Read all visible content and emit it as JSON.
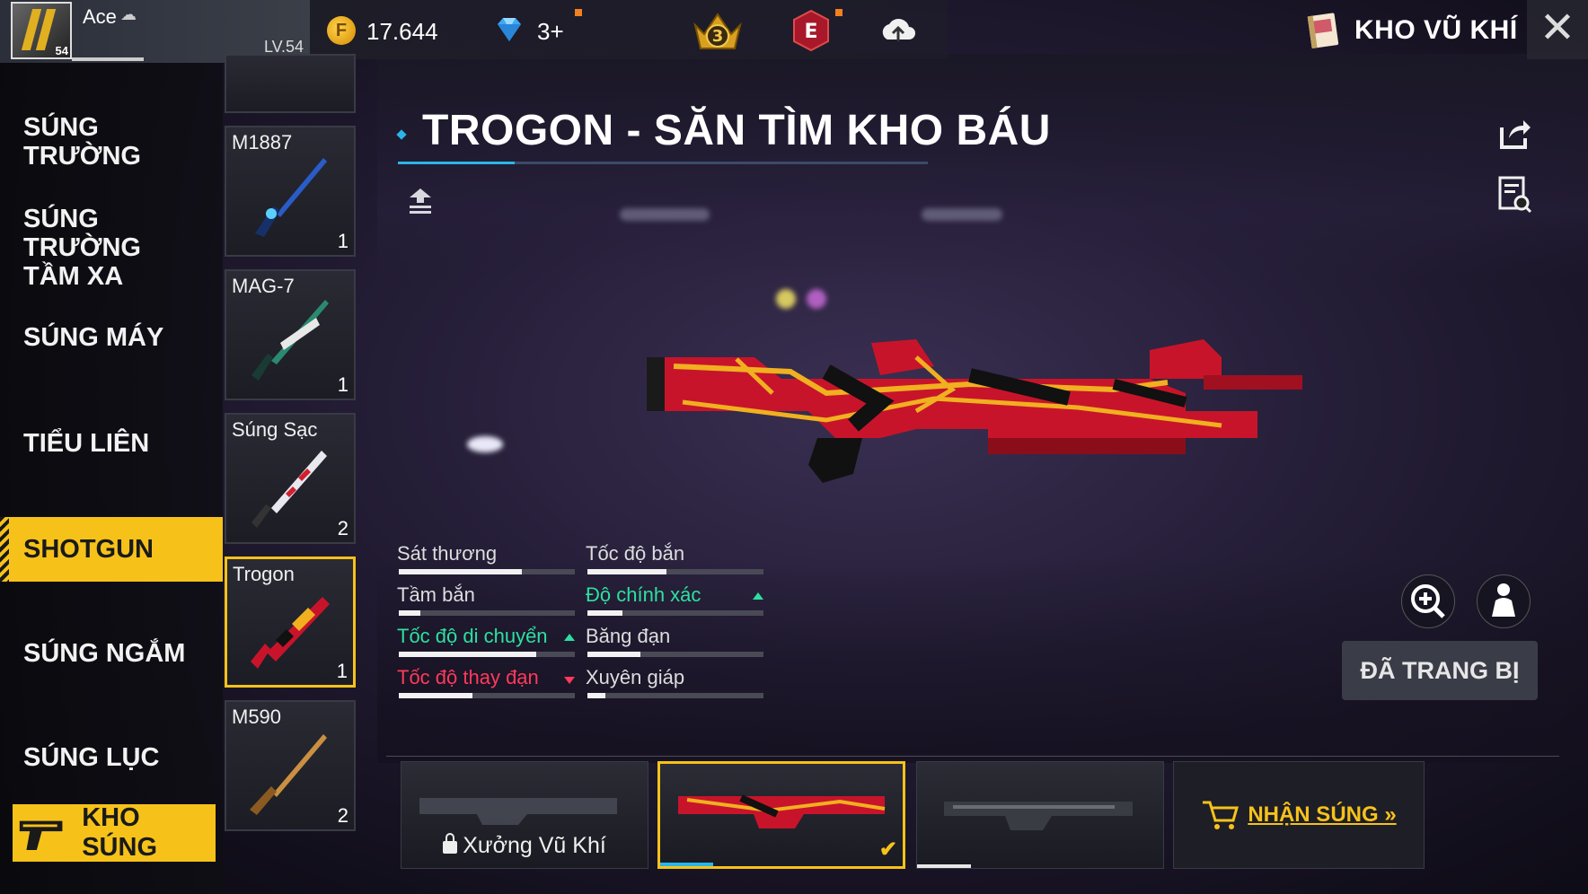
{
  "header": {
    "player": {
      "name": "Ace",
      "level": "LV.54",
      "badge_level": "54"
    },
    "coins": "17.644",
    "diamonds": "3+",
    "rank_badge": "3",
    "elite_badge": "E",
    "section_title": "KHO VŨ KHÍ",
    "icons": {
      "coin": "gold-coin-icon",
      "diamond": "diamond-icon",
      "rank": "rank-crown-icon",
      "elite": "elite-pass-icon",
      "cloud": "cloud-upload-icon",
      "armory": "armory-book-icon",
      "close": "close-icon"
    }
  },
  "categories": [
    {
      "label": "SÚNG TRƯỜNG"
    },
    {
      "label": "SÚNG TRƯỜNG TẦM XA"
    },
    {
      "label": "SÚNG MÁY"
    },
    {
      "label": "TIỂU LIÊN"
    },
    {
      "label": "SHOTGUN",
      "active": true
    },
    {
      "label": "SÚNG NGẮM"
    },
    {
      "label": "SÚNG LỤC"
    }
  ],
  "kho_sung_label": "KHO SÚNG",
  "weapons": [
    {
      "name": "M1887",
      "count": "1"
    },
    {
      "name": "MAG-7",
      "count": "1"
    },
    {
      "name": "Súng Sạc",
      "count": "2"
    },
    {
      "name": "Trogon",
      "count": "1",
      "selected": true
    },
    {
      "name": "M590",
      "count": "2"
    }
  ],
  "weapon_title": "TROGON - SĂN TÌM KHO BÁU",
  "stats": {
    "damage": {
      "label": "Sát thương",
      "value": 0.7
    },
    "rate_of_fire": {
      "label": "Tốc độ bắn",
      "value": 0.45
    },
    "range": {
      "label": "Tầm bắn",
      "value": 0.12
    },
    "accuracy": {
      "label": "Độ chính xác",
      "value": 0.2,
      "trend": "up"
    },
    "movement_speed": {
      "label": "Tốc độ di chuyển",
      "value": 0.78,
      "trend": "up"
    },
    "magazine": {
      "label": "Băng đạn",
      "value": 0.3
    },
    "reload_speed": {
      "label": "Tốc độ thay đạn",
      "value": 0.42,
      "trend": "down"
    },
    "armor_penetration": {
      "label": "Xuyên giáp",
      "value": 0.1
    }
  },
  "equip_status": "ĐÃ TRANG BỊ",
  "skins": [
    {
      "label": "Xưởng Vũ Khí",
      "locked": true
    },
    {
      "label": "",
      "selected": true,
      "progress": 0.22
    },
    {
      "label": "",
      "progress": 0.22
    }
  ],
  "get_gun_label": "NHẬN SÚNG »",
  "colors": {
    "accent": "#f6c21a",
    "highlight": "#29b6e8",
    "stat_up": "#2de0a0",
    "stat_down": "#ff3a5a"
  }
}
